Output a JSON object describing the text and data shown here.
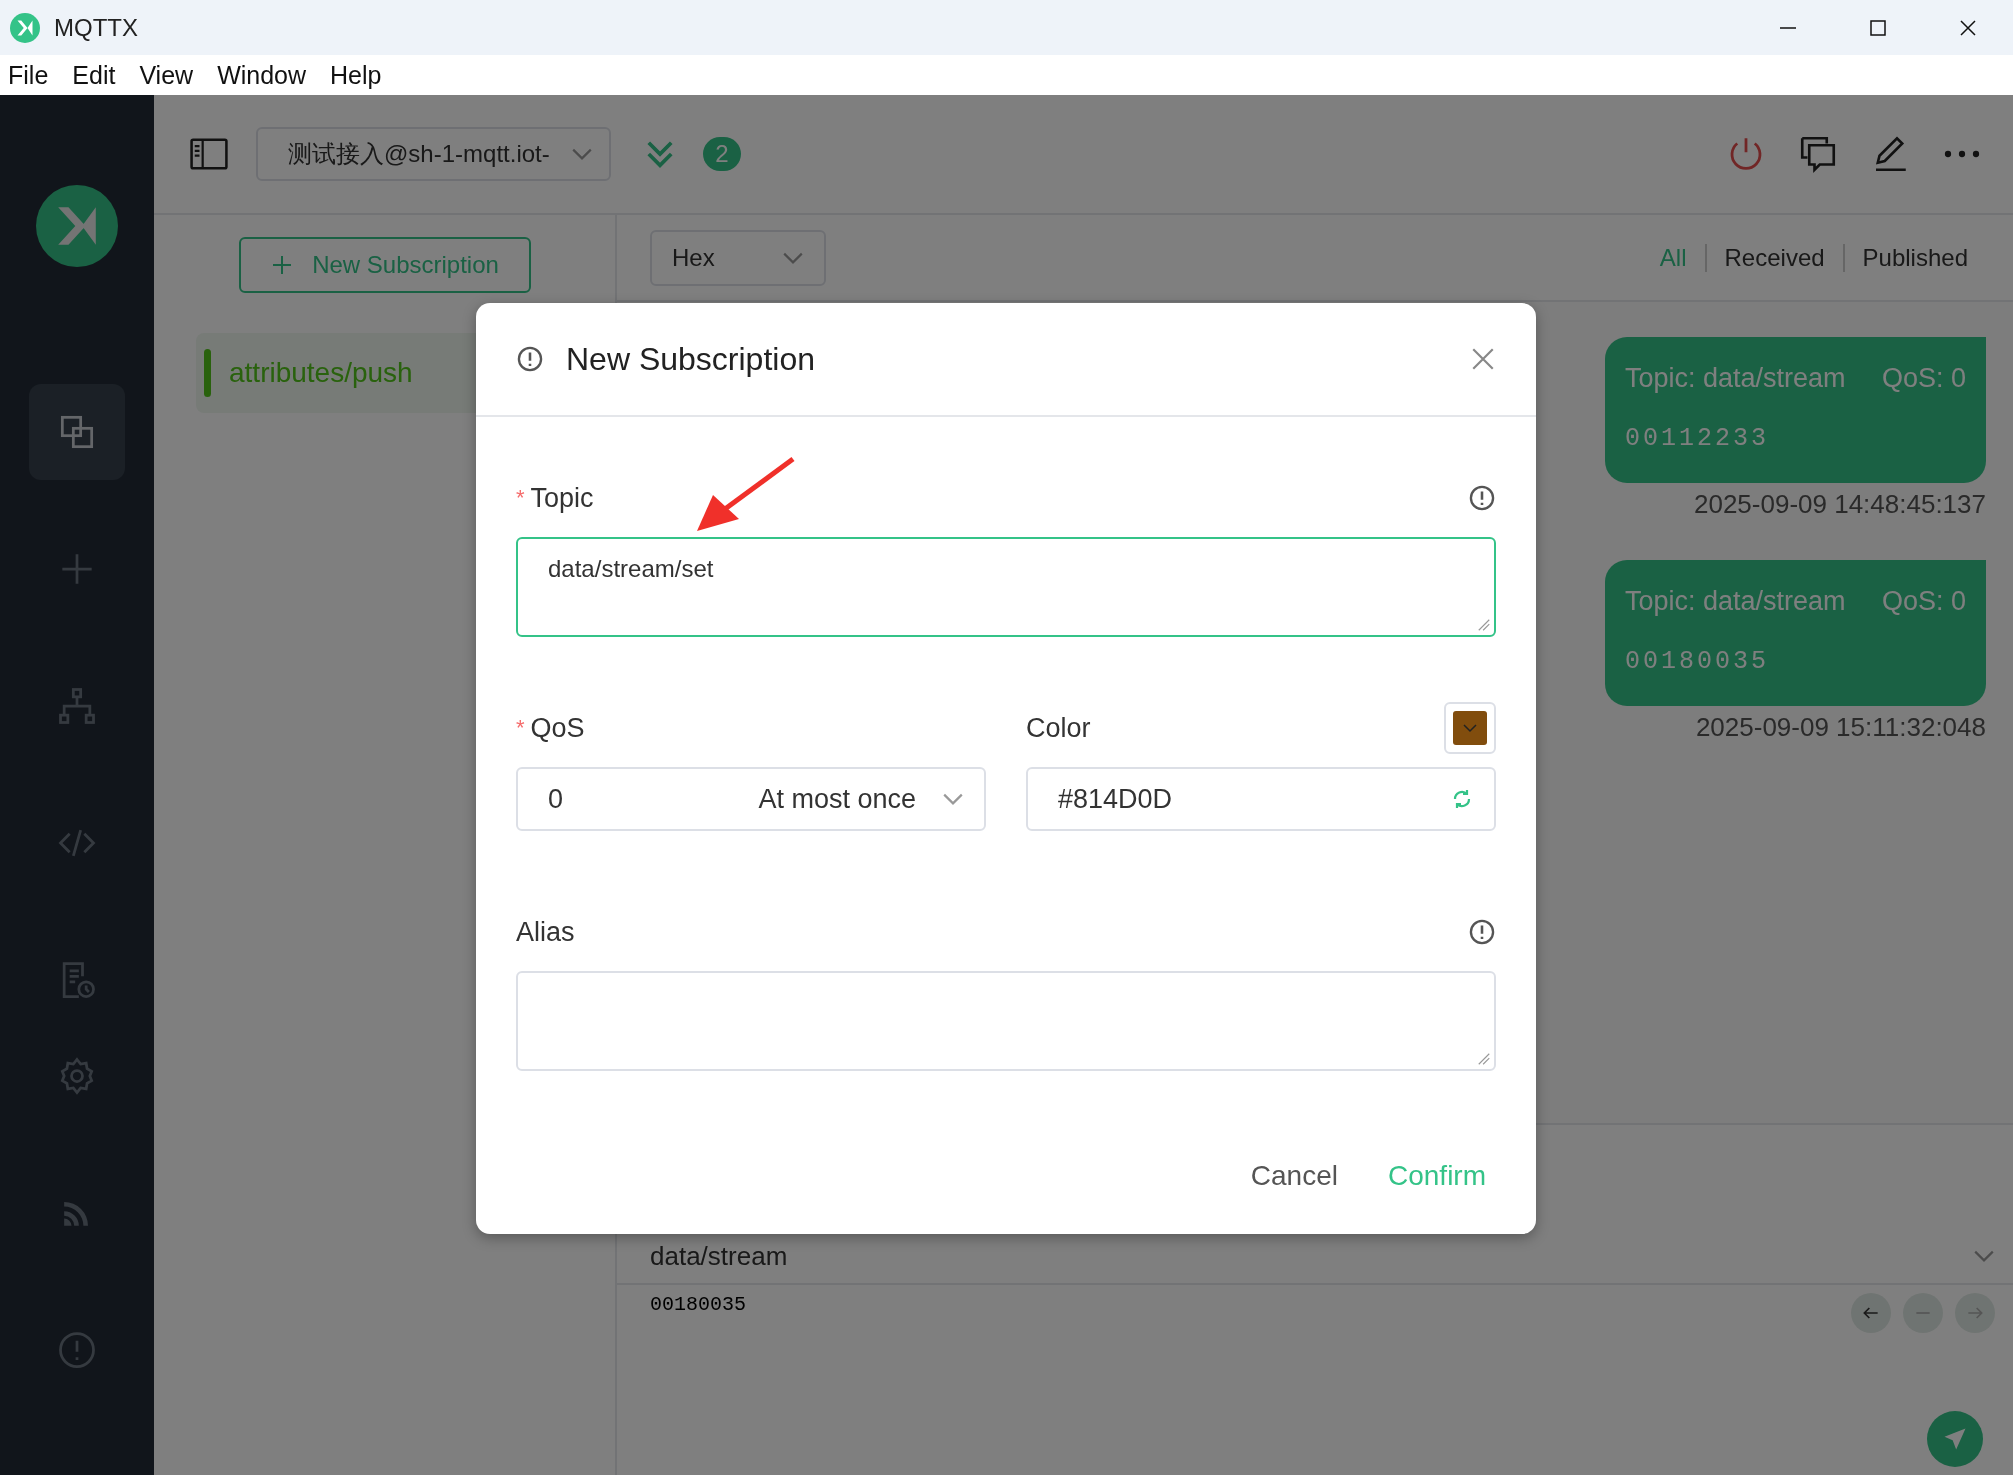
{
  "window": {
    "title": "MQTTX"
  },
  "menu": [
    "File",
    "Edit",
    "View",
    "Window",
    "Help"
  ],
  "sidebar": {
    "items": [
      {
        "kind": "connections",
        "selected": true
      },
      {
        "kind": "new",
        "selected": false
      },
      {
        "kind": "scripts",
        "selected": false
      },
      {
        "kind": "code",
        "selected": false
      },
      {
        "kind": "log",
        "selected": false
      },
      {
        "kind": "settings",
        "selected": false
      },
      {
        "kind": "feed",
        "selected": false
      },
      {
        "kind": "about",
        "selected": false
      }
    ]
  },
  "connection": {
    "name": "测试接入@sh-1-mqtt.iot-",
    "unread": "2"
  },
  "subscriptions": {
    "button": "New Subscription",
    "items": [
      {
        "topic": "attributes/push"
      }
    ]
  },
  "messages": {
    "format": "Hex",
    "filters": [
      {
        "label": "All",
        "selected": true
      },
      {
        "label": "Received",
        "selected": false
      },
      {
        "label": "Published",
        "selected": false
      }
    ],
    "items": [
      {
        "topic": "Topic: data/stream",
        "qos": "QoS: 0",
        "payload": "00112233",
        "time": "2025-09-09 14:48:45:137"
      },
      {
        "topic": "Topic: data/stream",
        "qos": "QoS: 0",
        "payload": "00180035",
        "time": "2025-09-09 15:11:32:048"
      }
    ]
  },
  "publish": {
    "topic": "data/stream",
    "payload": "00180035"
  },
  "dialog": {
    "title": "New Subscription",
    "topic": {
      "required_mark": "*",
      "label": "Topic",
      "value": "data/stream/set"
    },
    "qos": {
      "required_mark": "*",
      "label": "QoS",
      "value": "0",
      "text": "At most once"
    },
    "color": {
      "label": "Color",
      "value": "#814D0D"
    },
    "alias": {
      "label": "Alias"
    },
    "cancel": "Cancel",
    "confirm": "Confirm"
  }
}
